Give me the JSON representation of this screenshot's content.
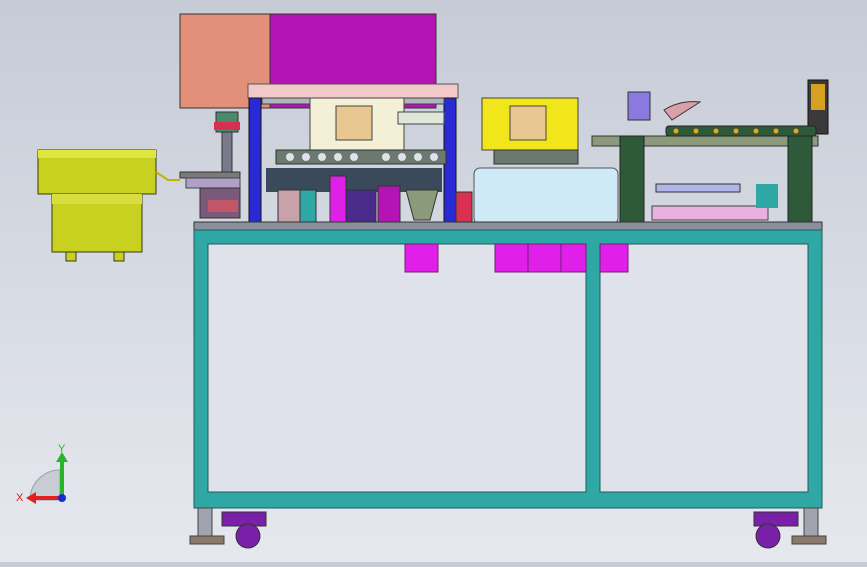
{
  "viewport": {
    "background_top": "#c6cbd6",
    "background_bottom": "#e6e8ee"
  },
  "triad": {
    "x_label": "X",
    "y_label": "Y",
    "x_color": "#e0201e",
    "y_color": "#28b428",
    "z_color": "#1a2ad0"
  },
  "colors": {
    "frame_teal": "#2ea7a5",
    "frame_inner": "#dfe2ea",
    "tabletop": "#8a8f9c",
    "magenta": "#e020e8",
    "purple": "#b414b4",
    "salmon": "#e3907a",
    "yellow_bowl": "#c8d020",
    "yellow_plate": "#f0e61a",
    "pale_plate": "#f4f0d8",
    "blue_post": "#2a2ad4",
    "dark_green": "#2e5a3a",
    "light_blue_box": "#cfe9f6",
    "caster": "#7a1fa8",
    "steel": "#a0a4ae"
  },
  "parts": [
    "vibratory-bowl-feeder",
    "main-frame",
    "motor-housing",
    "left-gantry",
    "center-gantry",
    "right-gantry",
    "cable-chain",
    "casters"
  ]
}
